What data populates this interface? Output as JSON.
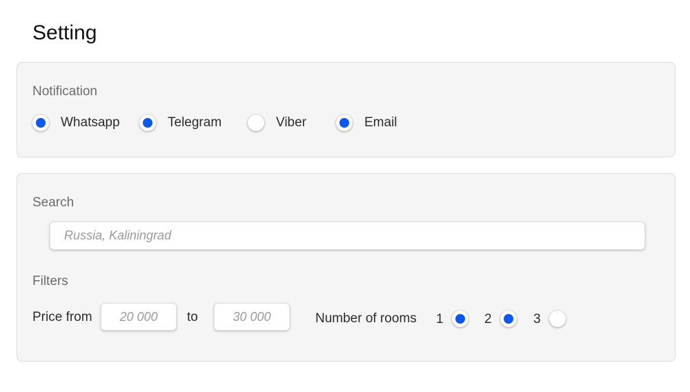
{
  "page": {
    "title": "Setting"
  },
  "notification": {
    "label": "Notification",
    "options": [
      {
        "label": "Whatsapp",
        "checked": true
      },
      {
        "label": "Telegram",
        "checked": true
      },
      {
        "label": "Viber",
        "checked": false
      },
      {
        "label": "Email",
        "checked": true
      }
    ]
  },
  "search": {
    "label": "Search",
    "placeholder": "Russia, Kaliningrad"
  },
  "filters": {
    "label": "Filters",
    "price_from_label": "Price from",
    "price_from_placeholder": "20 000",
    "to_label": "to",
    "price_to_placeholder": "30 000",
    "rooms_label": "Number of rooms",
    "rooms": [
      {
        "label": "1",
        "checked": true
      },
      {
        "label": "2",
        "checked": true
      },
      {
        "label": "3",
        "checked": false
      }
    ]
  },
  "colors": {
    "accent": "#0a57f5",
    "panel_background": "#f5f5f5",
    "panel_border": "#dcdcdc"
  }
}
